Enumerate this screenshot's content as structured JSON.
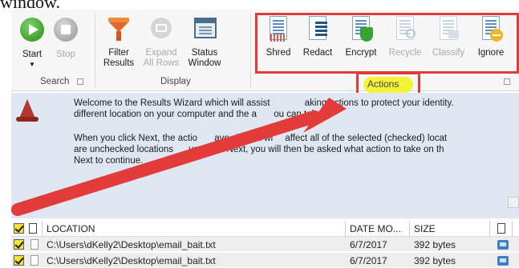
{
  "caption": {
    "text": "window."
  },
  "ribbon": {
    "groups": {
      "search": {
        "label": "Search"
      },
      "display": {
        "label": "Display"
      },
      "actions": {
        "label": "Actions"
      }
    },
    "buttons": {
      "start": "Start",
      "stop": "Stop",
      "filter_line1": "Filter",
      "filter_line2": "Results",
      "expand_line1": "Expand",
      "expand_line2": "All Rows",
      "status_line1": "Status",
      "status_line2": "Window",
      "shred": "Shred",
      "redact": "Redact",
      "encrypt": "Encrypt",
      "recycle": "Recycle",
      "classify": "Classify",
      "ignore": "Ignore"
    }
  },
  "wizard": {
    "line1": "Welcome to the Results Wizard which will assist",
    "line1b": "aking actions to protect your identity.",
    "line2": "different location on your computer and the a",
    "line2b": "ou can take.",
    "line3": "When you click Next, the actio",
    "line3b": "ave chosen wi",
    "line3c": "affect all of the selected (checked) locat",
    "line4": "are unchecked locations",
    "line4b": "you click Next, you will then be asked what action to take on th",
    "line5": "Next to continue."
  },
  "table": {
    "headers": {
      "location": "LOCATION",
      "date": "DATE MO...",
      "size": "SIZE"
    },
    "rows": [
      {
        "path": "C:\\Users\\dKelly2\\Desktop\\email_bait.txt",
        "date": "6/7/2017",
        "size": "392 bytes"
      },
      {
        "path": "C:\\Users\\dKelly2\\Desktop\\email_bait.txt",
        "date": "6/7/2017",
        "size": "392 bytes"
      }
    ]
  },
  "colors": {
    "annotation": "#e33a3a",
    "highlight": "#f4f33a",
    "start_green": "#3ca22c"
  }
}
